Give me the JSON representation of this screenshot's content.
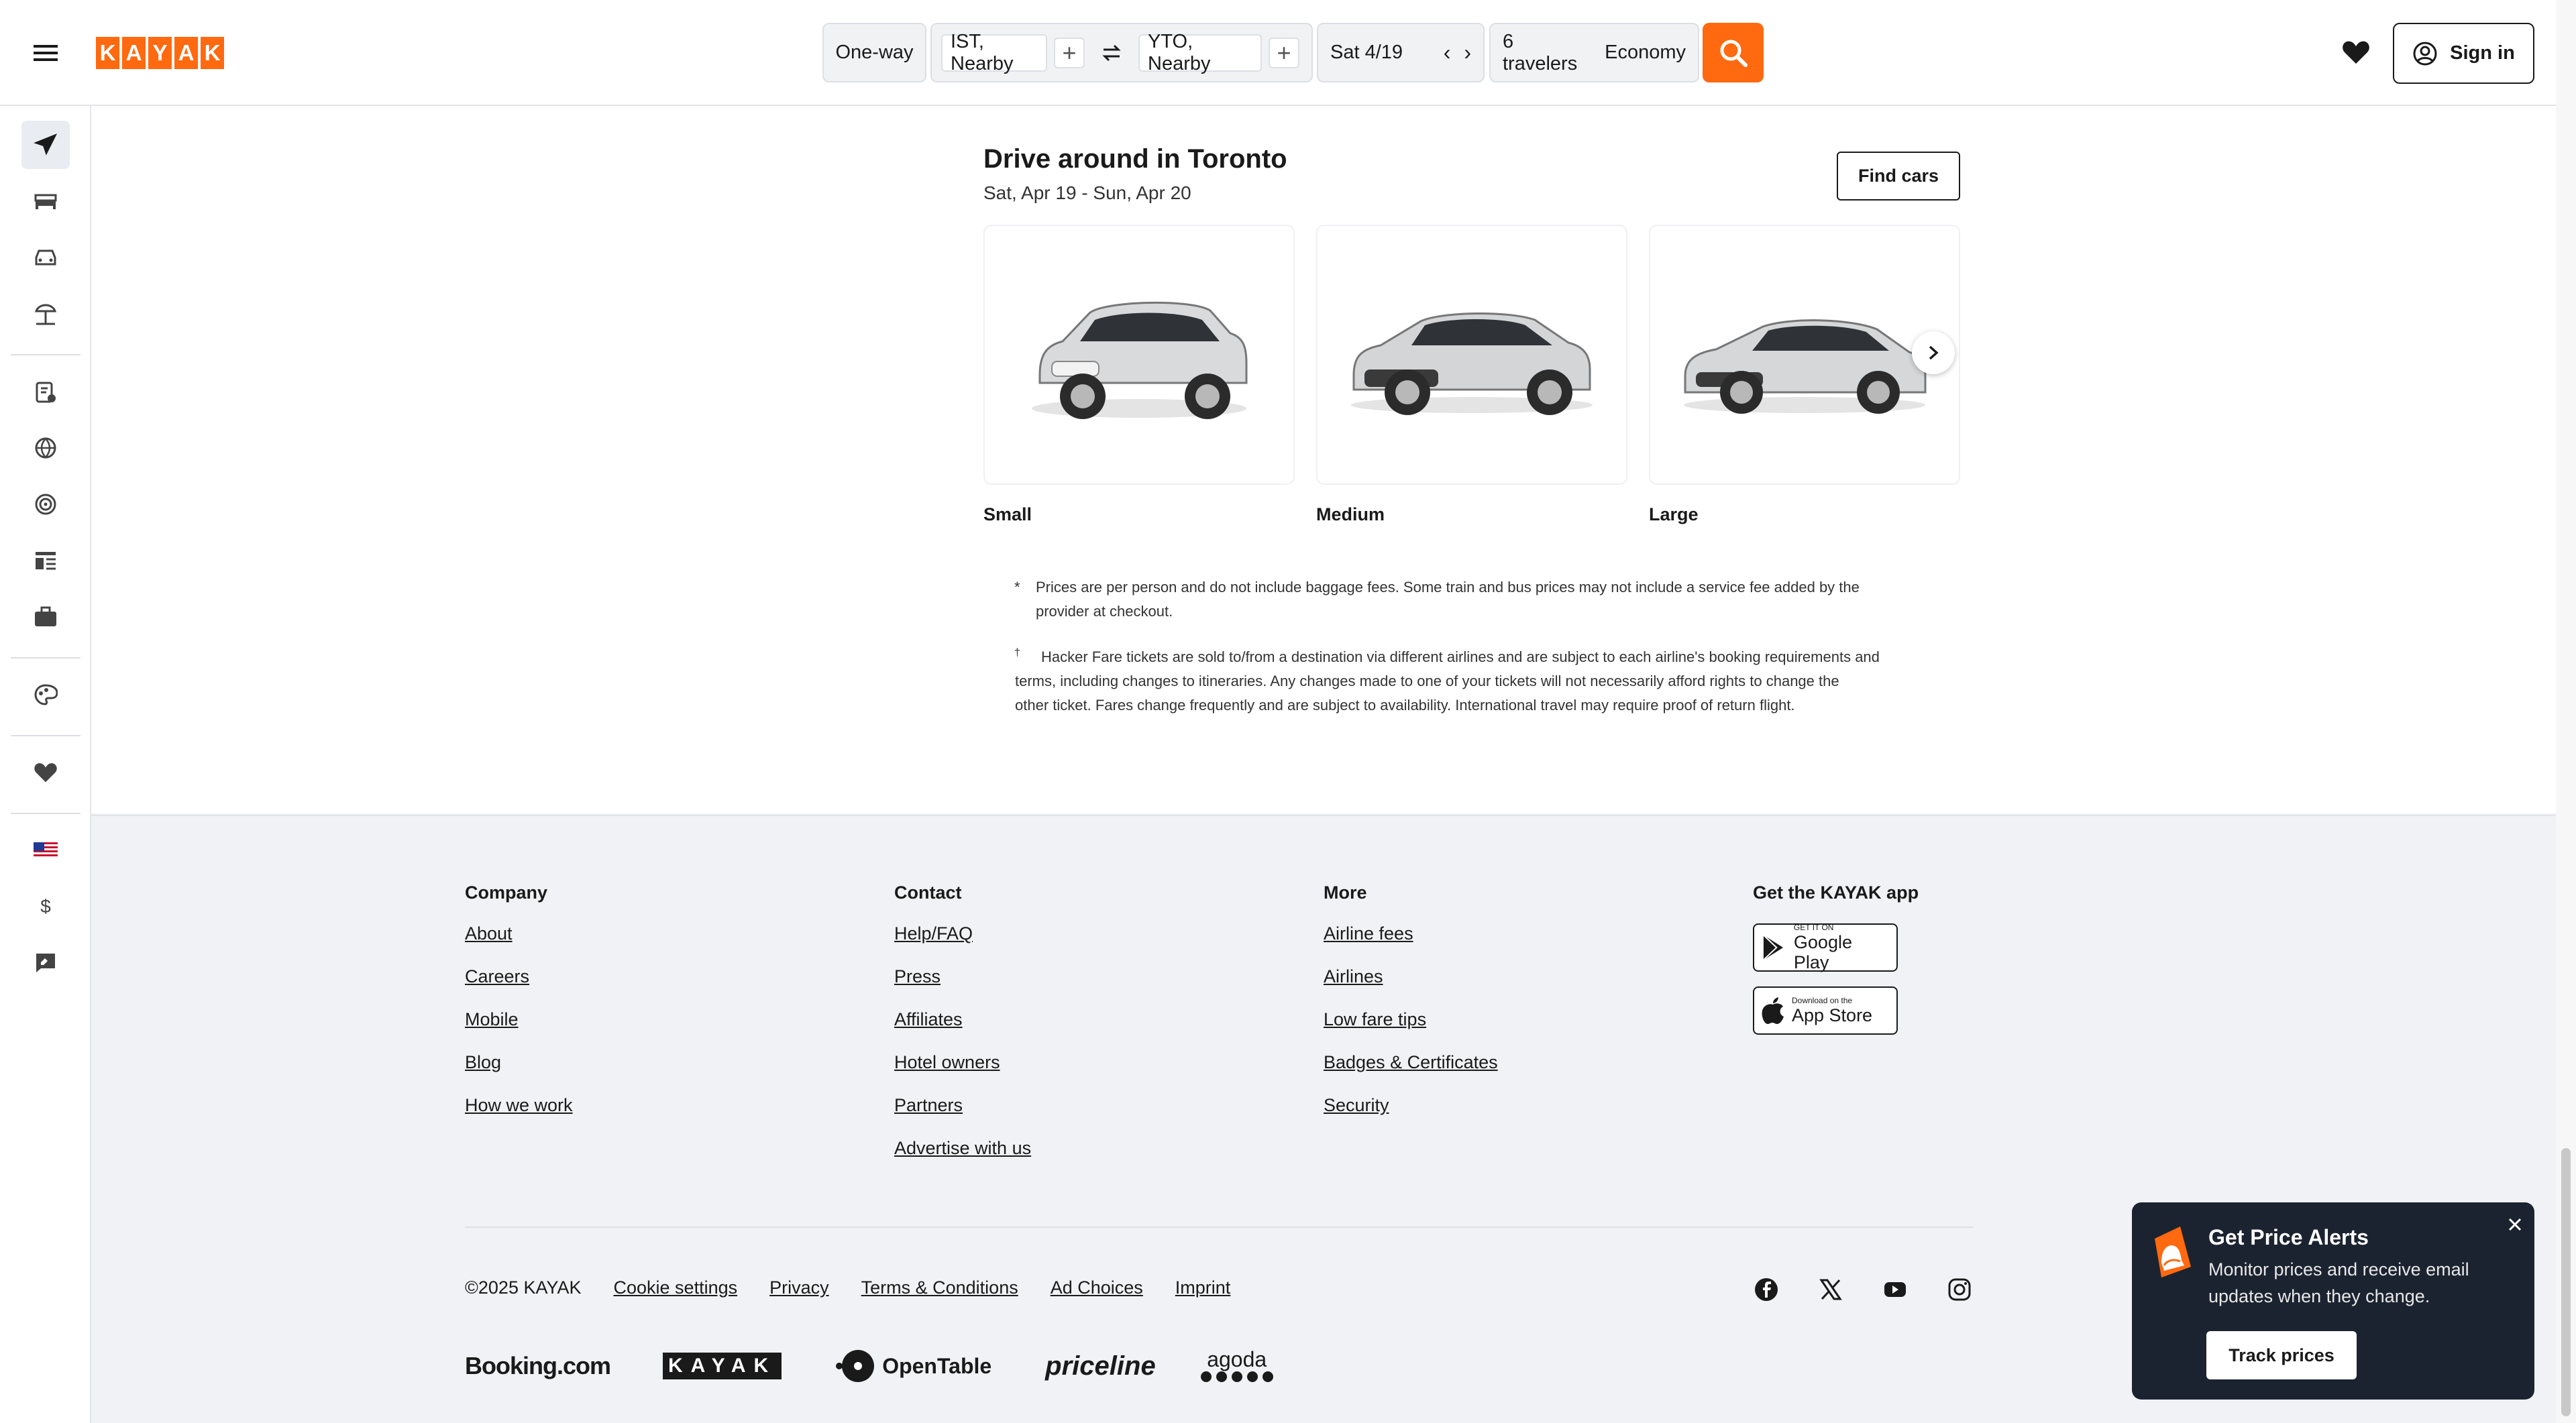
{
  "header": {
    "logo_letters": [
      "K",
      "A",
      "Y",
      "A",
      "K"
    ],
    "trip_type": "One-way",
    "origin": "IST, Nearby",
    "destination": "YTO, Nearby",
    "date": "Sat 4/19",
    "travelers": "6 travelers",
    "cabin": "Economy",
    "signin_label": "Sign in"
  },
  "sidebar": {
    "items": [
      "flights",
      "stays",
      "cars",
      "packages",
      "trips",
      "explore",
      "flight-tracker",
      "travel-guides",
      "business",
      "trips-ai",
      "favorites",
      "language-us",
      "currency",
      "feedback"
    ],
    "currency_symbol": "$"
  },
  "drive": {
    "title": "Drive around in Toronto",
    "dates": "Sat, Apr 19 - Sun, Apr 20",
    "find_cars": "Find cars",
    "cars": [
      {
        "label": "Small"
      },
      {
        "label": "Medium"
      },
      {
        "label": "Large"
      }
    ]
  },
  "notes": {
    "asterisk": "*",
    "price_note_1": "Prices are per person and do not include baggage fees. Some train and bus prices may not include a service fee added by the",
    "price_note_2": "provider at checkout.",
    "dagger": "†",
    "hacker_1": "Hacker Fare tickets are sold to/from a destination via different airlines and are subject to each airline's booking requirements and",
    "hacker_2": "terms, including changes to itineraries. Any changes made to one of your tickets will not necessarily afford rights to change the",
    "hacker_3": "other ticket. Fares change frequently and are subject to availability. International travel may require proof of return flight."
  },
  "footer": {
    "company": {
      "title": "Company",
      "links": [
        "About",
        "Careers",
        "Mobile",
        "Blog",
        "How we work"
      ]
    },
    "contact": {
      "title": "Contact",
      "links": [
        "Help/FAQ",
        "Press",
        "Affiliates",
        "Hotel owners",
        "Partners",
        "Advertise with us"
      ]
    },
    "more": {
      "title": "More",
      "links": [
        "Airline fees",
        "Airlines",
        "Low fare tips",
        "Badges & Certificates",
        "Security"
      ]
    },
    "app": {
      "title": "Get the KAYAK app",
      "google_small": "GET IT ON",
      "google_big": "Google Play",
      "apple_small": "Download on the",
      "apple_big": "App Store"
    },
    "copyright": "©2025 KAYAK",
    "bottom_links": [
      "Cookie settings",
      "Privacy",
      "Terms & Conditions",
      "Ad Choices",
      "Imprint"
    ],
    "brands": {
      "booking": "Booking.com",
      "kayak": "KAYAK",
      "opentable": "OpenTable",
      "priceline": "priceline",
      "agoda": "agoda"
    }
  },
  "price_alert": {
    "title": "Get Price Alerts",
    "message": "Monitor prices and receive email updates when they change.",
    "button": "Track prices"
  },
  "colors": {
    "accent": "#ff690f",
    "dark": "#1c2330"
  }
}
